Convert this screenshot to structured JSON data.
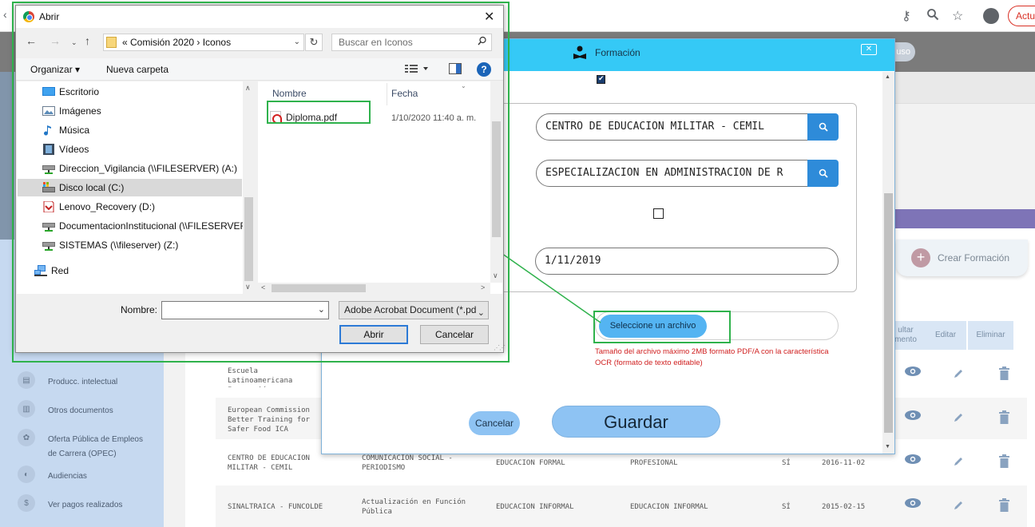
{
  "browser": {
    "update_label": "Actu"
  },
  "header": {
    "pill_text": "uso"
  },
  "sidebar": {
    "items": [
      {
        "label": "Producc. intelectual"
      },
      {
        "label": "Otros documentos"
      },
      {
        "label": "Oferta Pública de Empleos de Carrera (OPEC)"
      },
      {
        "label": "Audiencias"
      },
      {
        "label": "Ver pagos realizados"
      }
    ]
  },
  "page": {
    "create_label": "Crear Formación",
    "table_headers": [
      "ultar mento",
      "Editar",
      "Eliminar"
    ],
    "rows": [
      {
        "institucion": "Escuela Latinoamericana Innovación Agroalimentaria",
        "programa": "",
        "modalidad": "",
        "nivel": "",
        "graduado": "",
        "fecha": ""
      },
      {
        "institucion": "European Commission Better Training for Safer Food ICA",
        "programa": "",
        "modalidad": "",
        "nivel": "",
        "graduado": "",
        "fecha": ""
      },
      {
        "institucion": "CENTRO DE EDUCACION MILITAR - CEMIL",
        "programa": "COMUNICACION SOCIAL - PERIODISMO",
        "modalidad": "EDUCACION FORMAL",
        "nivel": "PROFESIONAL",
        "graduado": "SÍ",
        "fecha": "2016-11-02"
      },
      {
        "institucion": "SINALTRAICA - FUNCOLDE",
        "programa": "Actualización en Función Pública",
        "modalidad": "EDUCACION INFORMAL",
        "nivel": "EDUCACION INFORMAL",
        "graduado": "SÍ",
        "fecha": "2015-02-15"
      }
    ]
  },
  "modal": {
    "title": "Formación",
    "institution_value": "CENTRO DE EDUCACION MILITAR - CEMIL",
    "program_value": "ESPECIALIZACION EN ADMINISTRACION DE R",
    "date_value": "1/11/2019",
    "file_button_label": "Seleccione un archivo",
    "file_note": "Tamaño del archivo máximo 2MB formato PDF/A con la característica OCR (formato de texto editable)",
    "cancel_label": "Cancelar",
    "save_label": "Guardar"
  },
  "dialog": {
    "title": "Abrir",
    "path": "«  Comisión 2020  ›  Iconos",
    "search_placeholder": "Buscar en Iconos",
    "toolbar": {
      "organize": "Organizar ▾",
      "new_folder": "Nueva carpeta"
    },
    "tree": [
      {
        "label": "Escritorio",
        "icon": "desktop-icon"
      },
      {
        "label": "Imágenes",
        "icon": "pictures-icon"
      },
      {
        "label": "Música",
        "icon": "music-icon"
      },
      {
        "label": "Vídeos",
        "icon": "videos-icon"
      },
      {
        "label": "Direccion_Vigilancia (\\\\FILESERVER) (A:)",
        "icon": "network-drive-icon"
      },
      {
        "label": "Disco local (C:)",
        "icon": "local-disk-icon",
        "selected": true
      },
      {
        "label": "Lenovo_Recovery (D:)",
        "icon": "recovery-drive-icon"
      },
      {
        "label": "DocumentacionInstitucional (\\\\FILESERVER)",
        "icon": "network-drive-icon"
      },
      {
        "label": "SISTEMAS (\\\\fileserver) (Z:)",
        "icon": "network-drive-icon"
      },
      {
        "label": "Red",
        "icon": "network-icon"
      }
    ],
    "columns": {
      "name": "Nombre",
      "date": "Fecha"
    },
    "files": [
      {
        "name": "Diploma.pdf",
        "date": "1/10/2020 11:40 a. m."
      }
    ],
    "name_label": "Nombre:",
    "name_value": "",
    "type_value": "Adobe Acrobat Document (*.pdf)",
    "open_label": "Abrir",
    "cancel_label": "Cancelar"
  },
  "colors": {
    "annotation_green": "#2fb24c",
    "modal_header": "#35c9f6",
    "accent_blue": "#2e8bd9"
  }
}
